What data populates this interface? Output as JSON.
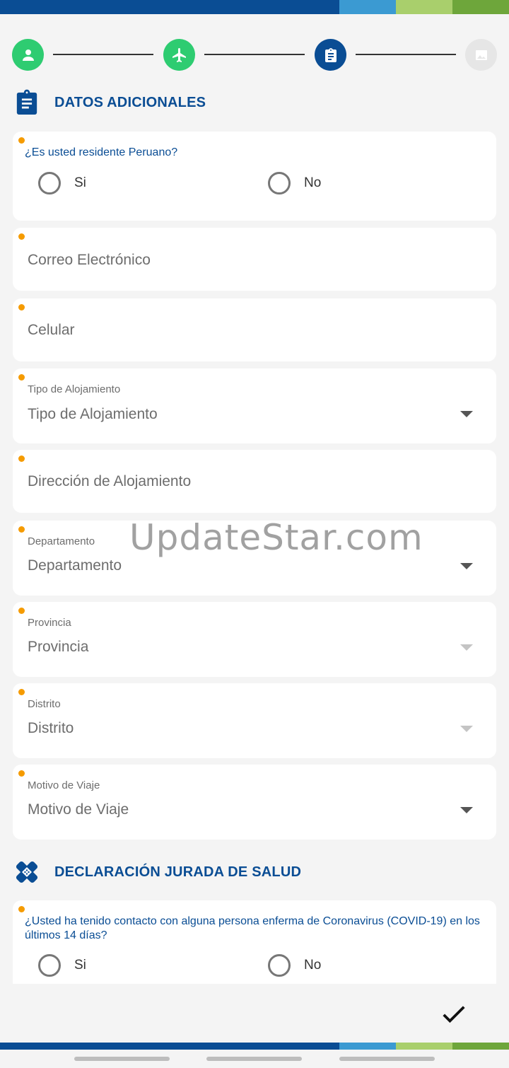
{
  "colors": {
    "brand_blue": "#0a4d94",
    "step_done_green": "#2ecc71",
    "required_dot": "#f59b00"
  },
  "stepper": {
    "steps": [
      {
        "icon": "person-icon",
        "state": "done"
      },
      {
        "icon": "airplane-icon",
        "state": "done"
      },
      {
        "icon": "clipboard-icon",
        "state": "active"
      },
      {
        "icon": "image-icon",
        "state": "pending"
      }
    ]
  },
  "datos": {
    "title": "DATOS ADICIONALES",
    "resident": {
      "question": "¿Es usted residente Peruano?",
      "yes": "Si",
      "no": "No"
    },
    "email": {
      "placeholder": "Correo Electrónico"
    },
    "phone": {
      "placeholder": "Celular"
    },
    "lodging_type": {
      "label": "Tipo de Alojamiento",
      "value": "Tipo de Alojamiento"
    },
    "lodging_address": {
      "placeholder": "Dirección de Alojamiento"
    },
    "department": {
      "label": "Departamento",
      "value": "Departamento"
    },
    "province": {
      "label": "Provincia",
      "value": "Provincia"
    },
    "district": {
      "label": "Distrito",
      "value": "Distrito"
    },
    "travel_reason": {
      "label": "Motivo de Viaje",
      "value": "Motivo de Viaje"
    }
  },
  "salud": {
    "title": "DECLARACIÓN JURADA DE SALUD",
    "contact": {
      "question": "¿Usted ha tenido contacto con alguna persona enferma de Coronavirus (COVID-19) en los últimos 14 días?",
      "yes": "Si",
      "no": "No"
    }
  },
  "watermark": "UpdateStar.com"
}
